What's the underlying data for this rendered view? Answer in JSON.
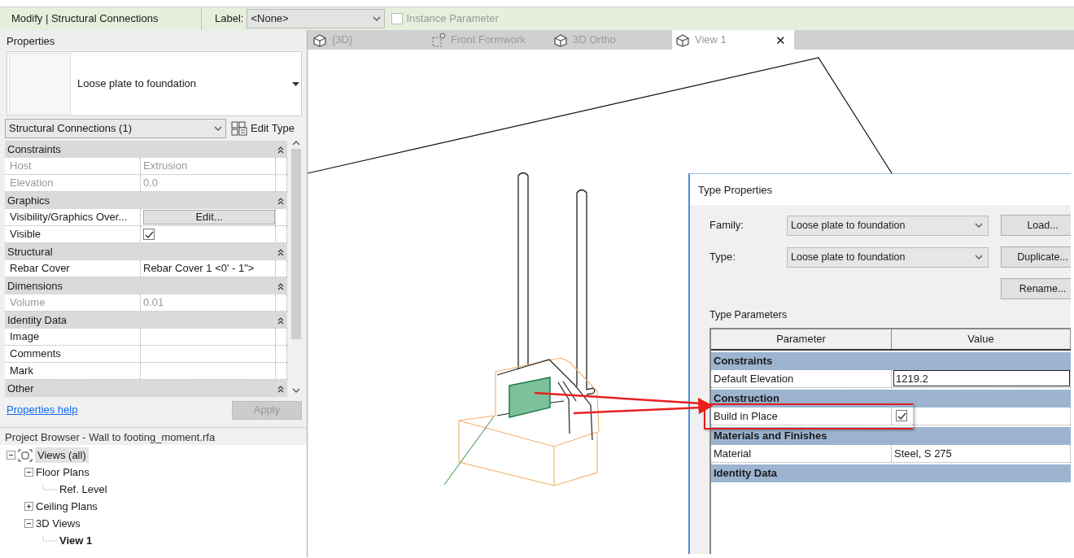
{
  "ribbon_bar": {
    "context": "Modify | Structural Connections",
    "label_caption": "Label:",
    "label_value": "<None>",
    "instance_parameter": {
      "label": "Instance Parameter",
      "checked": false,
      "disabled": true
    }
  },
  "properties": {
    "title": "Properties",
    "type_name": "Loose plate to foundation",
    "filter": "Structural Connections (1)",
    "edit_type": "Edit Type",
    "groups": [
      {
        "name": "Constraints",
        "rows": [
          {
            "name": "Host",
            "value": "Extrusion",
            "kind": "text",
            "disabled": true
          },
          {
            "name": "Elevation",
            "value": "0.0",
            "kind": "text",
            "disabled": true
          }
        ]
      },
      {
        "name": "Graphics",
        "rows": [
          {
            "name": "Visibility/Graphics Over...",
            "value": "Edit...",
            "kind": "button",
            "disabled": false
          },
          {
            "name": "Visible",
            "kind": "checkbox",
            "checked": true,
            "disabled": false
          }
        ]
      },
      {
        "name": "Structural",
        "rows": [
          {
            "name": "Rebar Cover",
            "value": "Rebar Cover 1 <0' - 1\">",
            "kind": "text",
            "disabled": false
          }
        ]
      },
      {
        "name": "Dimensions",
        "rows": [
          {
            "name": "Volume",
            "value": "0.01",
            "kind": "text",
            "disabled": true
          }
        ]
      },
      {
        "name": "Identity Data",
        "rows": [
          {
            "name": "Image",
            "kind": "text",
            "disabled": false
          },
          {
            "name": "Comments",
            "kind": "text",
            "disabled": false
          },
          {
            "name": "Mark",
            "kind": "text",
            "disabled": false
          }
        ]
      },
      {
        "name": "Other"
      }
    ],
    "help": "Properties help",
    "apply": {
      "label": "Apply",
      "disabled": true
    }
  },
  "project_browser": {
    "title": "Project Browser - Wall to footing_moment.rfa",
    "tree": [
      {
        "label": "Views (all)",
        "expanded": true,
        "selected": true,
        "current": false,
        "children": [
          {
            "label": "Floor Plans",
            "expanded": true,
            "selected": false,
            "current": false,
            "children": [
              {
                "label": "Ref. Level",
                "selected": false,
                "current": false
              }
            ]
          },
          {
            "label": "Ceiling Plans",
            "expanded": false,
            "selected": false,
            "current": false
          },
          {
            "label": "3D Views",
            "expanded": true,
            "selected": false,
            "current": false,
            "children": [
              {
                "label": "View 1",
                "selected": false,
                "current": true
              }
            ]
          }
        ]
      }
    ]
  },
  "view_tabs": [
    {
      "label": "{3D}",
      "kind": "model",
      "selected": false
    },
    {
      "label": "Front Formwork",
      "kind": "elevation",
      "selected": false
    },
    {
      "label": "3D Ortho",
      "kind": "model",
      "selected": false
    },
    {
      "label": "View 1",
      "kind": "model",
      "selected": true,
      "close": "✕"
    }
  ],
  "type_properties": {
    "title": "Type Properties",
    "family_label": "Family:",
    "family_value": "Loose plate to foundation",
    "type_label": "Type:",
    "type_value": "Loose plate to foundation",
    "buttons": [
      "Load...",
      "Duplicate...",
      "Rename..."
    ],
    "section": "Type Parameters",
    "columns": [
      "Parameter",
      "Value"
    ],
    "groups": [
      {
        "name": "Constraints",
        "rows": [
          {
            "name": "Default Elevation",
            "value": "1219.2",
            "kind": "input",
            "highlighted": false
          }
        ]
      },
      {
        "name": "Construction",
        "rows": [
          {
            "name": "Build in Place",
            "kind": "checkbox",
            "checked": true,
            "highlighted": true
          }
        ]
      },
      {
        "name": "Materials and Finishes",
        "rows": [
          {
            "name": "Material",
            "value": "Steel, S 275",
            "kind": "text",
            "highlighted": false
          }
        ]
      },
      {
        "name": "Identity Data"
      }
    ]
  }
}
